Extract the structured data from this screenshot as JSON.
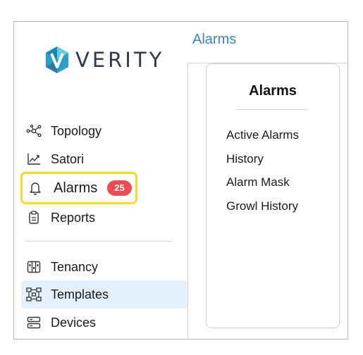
{
  "brand": {
    "name": "VERITY",
    "logo_icon": "hexagon-v-logo"
  },
  "sidebar": {
    "items": [
      {
        "label": "Topology",
        "icon": "topology-icon"
      },
      {
        "label": "Satori",
        "icon": "chart-icon"
      },
      {
        "label": "Alarms",
        "icon": "bell-icon",
        "badge": "25"
      },
      {
        "label": "Reports",
        "icon": "clipboard-icon"
      },
      {
        "label": "Tenancy",
        "icon": "tenancy-icon"
      },
      {
        "label": "Templates",
        "icon": "templates-icon",
        "selected": true
      },
      {
        "label": "Devices",
        "icon": "devices-icon"
      }
    ]
  },
  "page": {
    "title": "Alarms"
  },
  "card": {
    "title": "Alarms",
    "links": [
      "Active Alarms",
      "History",
      "Alarm Mask",
      "Growl History"
    ]
  },
  "colors": {
    "accent": "#3a86c8",
    "badge": "#f04b52",
    "highlight": "#f4d92c",
    "selected_bg": "#e4f0fb"
  }
}
